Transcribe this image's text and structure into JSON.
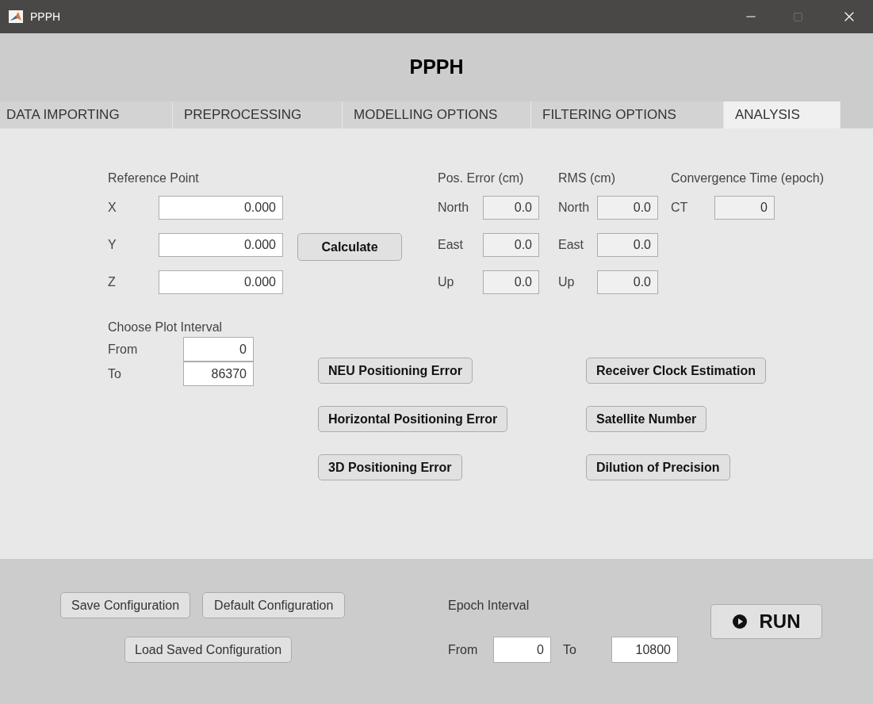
{
  "window": {
    "title": "PPPH"
  },
  "header": "PPPH",
  "tabs": [
    {
      "label": "DATA IMPORTING",
      "selected": false
    },
    {
      "label": "PREPROCESSING",
      "selected": false
    },
    {
      "label": "MODELLING OPTIONS",
      "selected": false
    },
    {
      "label": "FILTERING OPTIONS",
      "selected": false
    },
    {
      "label": "ANALYSIS",
      "selected": true
    }
  ],
  "reference_point": {
    "title": "Reference Point",
    "rows": [
      {
        "label": "X",
        "value": "0.000"
      },
      {
        "label": "Y",
        "value": "0.000"
      },
      {
        "label": "Z",
        "value": "0.000"
      }
    ]
  },
  "calculate_button": "Calculate",
  "result_groups": [
    {
      "title": "Pos. Error (cm)",
      "rows": [
        {
          "label": "North",
          "value": "0.0",
          "readonly": true
        },
        {
          "label": "East",
          "value": "0.0",
          "readonly": true
        },
        {
          "label": "Up",
          "value": "0.0",
          "readonly": true
        }
      ]
    },
    {
      "title": "RMS (cm)",
      "rows": [
        {
          "label": "North",
          "value": "0.0",
          "readonly": true
        },
        {
          "label": "East",
          "value": "0.0",
          "readonly": true
        },
        {
          "label": "Up",
          "value": "0.0",
          "readonly": true
        }
      ]
    },
    {
      "title": "Convergence Time (epoch)",
      "rows": [
        {
          "label": "CT",
          "value": "0",
          "readonly": true
        }
      ]
    }
  ],
  "plot_interval": {
    "title": "Choose Plot Interval",
    "from": {
      "label": "From",
      "value": "0"
    },
    "to": {
      "label": "To",
      "value": "86370"
    }
  },
  "plot_buttons": [
    [
      "NEU Positioning Error",
      "Horizontal Positioning Error",
      "3D Positioning Error"
    ],
    [
      "Receiver Clock Estimation",
      "Satellite Number",
      "Dilution of Precision"
    ]
  ],
  "footer": {
    "save_button": "Save Configuration",
    "default_button": "Default Configuration",
    "load_button": "Load Saved Configuration",
    "epoch_interval": {
      "title": "Epoch Interval",
      "from": {
        "label": "From",
        "value": "0"
      },
      "to": {
        "label": "To",
        "value": "10800"
      }
    },
    "run_button": "RUN"
  }
}
